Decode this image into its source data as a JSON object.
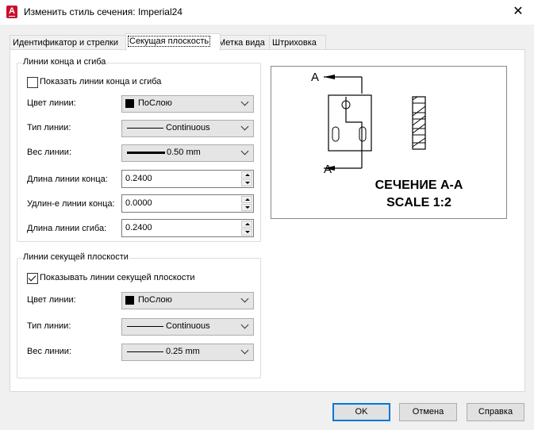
{
  "window": {
    "title": "Изменить стиль сечения: Imperial24",
    "app_icon_letter": "A"
  },
  "tabs": [
    {
      "label": "Идентификатор и стрелки"
    },
    {
      "label": "Секущая плоскость",
      "active": true
    },
    {
      "label": "Метка вида"
    },
    {
      "label": "Штриховка"
    }
  ],
  "end_lines": {
    "group_title": "Линии конца и сгиба",
    "show_label": "Показать линии конца и сгиба",
    "show_checked": false,
    "color_label": "Цвет линии:",
    "color_value": "ПоСлою",
    "linetype_label": "Тип линии:",
    "linetype_value": "Continuous",
    "weight_label": "Вес линии:",
    "weight_value": "0.50 mm",
    "end_length_label": "Длина линии конца:",
    "end_length_value": "0.2400",
    "extension_label": "Удлин-е линии конца:",
    "extension_value": "0.0000",
    "bend_length_label": "Длина линии сгиба:",
    "bend_length_value": "0.2400"
  },
  "cutting_plane": {
    "group_title": "Линии секущей плоскости",
    "show_label": "Показывать линии секущей плоскости",
    "show_checked": true,
    "color_label": "Цвет линии:",
    "color_value": "ПоСлою",
    "linetype_label": "Тип линии:",
    "linetype_value": "Continuous",
    "weight_label": "Вес линии:",
    "weight_value": "0.25 mm"
  },
  "preview": {
    "arrow_label_top": "A",
    "arrow_label_bottom": "A",
    "caption_line1": "СЕЧЕНИЕ А-А",
    "caption_line2": "SCALE 1:2"
  },
  "buttons": {
    "ok": "OK",
    "cancel": "Отмена",
    "help": "Справка"
  },
  "colors": {
    "accent": "#0078d7",
    "app_icon": "#c8102e"
  }
}
